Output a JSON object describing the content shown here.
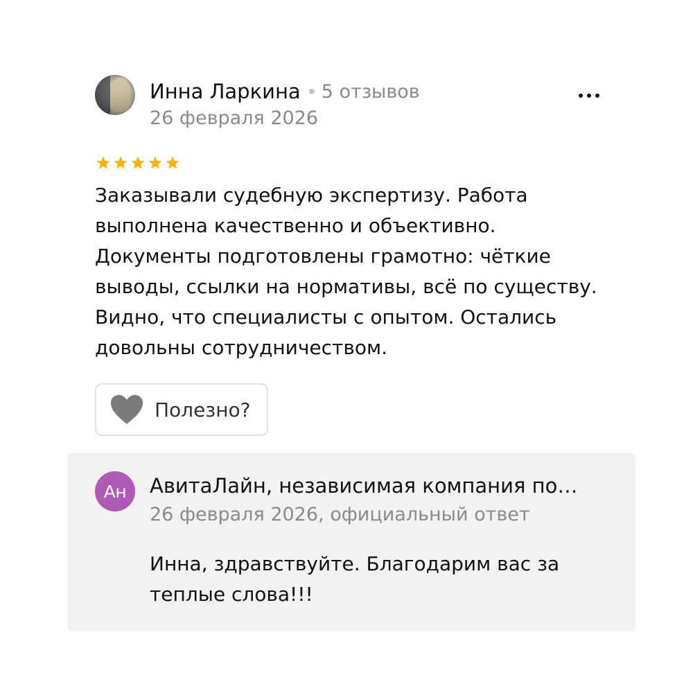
{
  "review": {
    "author": {
      "name": "Инна Ларкина",
      "review_count": "5 отзывов",
      "avatar_icon": "user-photo-avatar"
    },
    "date": "26 февраля 2026",
    "more_icon": "more-horizontal-icon",
    "rating": 5,
    "rating_max": 5,
    "star_color": "#FFB300",
    "text": "Заказывали судебную экспертизу. Работа выполнена качественно и объективно. Документы подготовлены грамотно: чёткие выводы, ссылки на нормативы, всё по существу. Видно, что специалисты с опытом. Остались довольны сотрудничеством.",
    "useful_button": {
      "icon": "heart-icon",
      "label": "Полезно?"
    }
  },
  "reply": {
    "avatar_initials": "Ан",
    "avatar_color": "#B05AB8",
    "company": "АвитаЛайн, независимая компания по…",
    "meta": "26 февраля 2026, официальный ответ",
    "text": "Инна, здравствуйте. Благодарим вас за теплые слова!!!"
  }
}
